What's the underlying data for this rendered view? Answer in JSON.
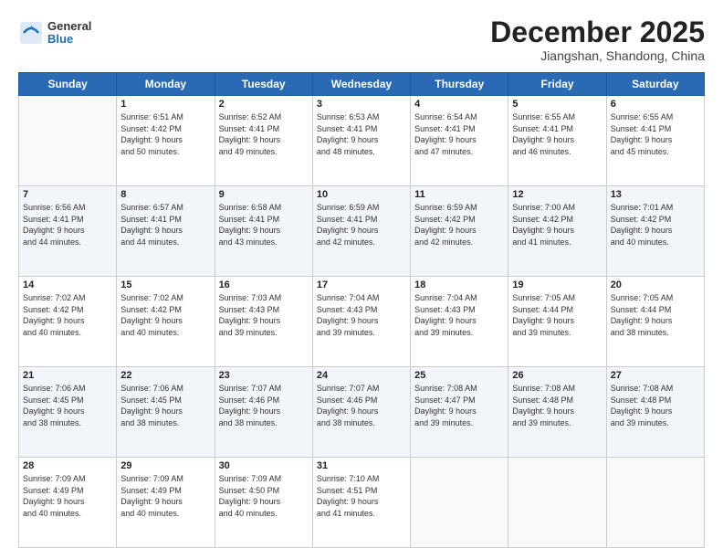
{
  "header": {
    "logo": {
      "general": "General",
      "blue": "Blue"
    },
    "title": "December 2025",
    "location": "Jiangshan, Shandong, China"
  },
  "weekdays": [
    "Sunday",
    "Monday",
    "Tuesday",
    "Wednesday",
    "Thursday",
    "Friday",
    "Saturday"
  ],
  "weeks": [
    [
      {
        "day": "",
        "info": ""
      },
      {
        "day": "1",
        "info": "Sunrise: 6:51 AM\nSunset: 4:42 PM\nDaylight: 9 hours\nand 50 minutes."
      },
      {
        "day": "2",
        "info": "Sunrise: 6:52 AM\nSunset: 4:41 PM\nDaylight: 9 hours\nand 49 minutes."
      },
      {
        "day": "3",
        "info": "Sunrise: 6:53 AM\nSunset: 4:41 PM\nDaylight: 9 hours\nand 48 minutes."
      },
      {
        "day": "4",
        "info": "Sunrise: 6:54 AM\nSunset: 4:41 PM\nDaylight: 9 hours\nand 47 minutes."
      },
      {
        "day": "5",
        "info": "Sunrise: 6:55 AM\nSunset: 4:41 PM\nDaylight: 9 hours\nand 46 minutes."
      },
      {
        "day": "6",
        "info": "Sunrise: 6:55 AM\nSunset: 4:41 PM\nDaylight: 9 hours\nand 45 minutes."
      }
    ],
    [
      {
        "day": "7",
        "info": "Sunrise: 6:56 AM\nSunset: 4:41 PM\nDaylight: 9 hours\nand 44 minutes."
      },
      {
        "day": "8",
        "info": "Sunrise: 6:57 AM\nSunset: 4:41 PM\nDaylight: 9 hours\nand 44 minutes."
      },
      {
        "day": "9",
        "info": "Sunrise: 6:58 AM\nSunset: 4:41 PM\nDaylight: 9 hours\nand 43 minutes."
      },
      {
        "day": "10",
        "info": "Sunrise: 6:59 AM\nSunset: 4:41 PM\nDaylight: 9 hours\nand 42 minutes."
      },
      {
        "day": "11",
        "info": "Sunrise: 6:59 AM\nSunset: 4:42 PM\nDaylight: 9 hours\nand 42 minutes."
      },
      {
        "day": "12",
        "info": "Sunrise: 7:00 AM\nSunset: 4:42 PM\nDaylight: 9 hours\nand 41 minutes."
      },
      {
        "day": "13",
        "info": "Sunrise: 7:01 AM\nSunset: 4:42 PM\nDaylight: 9 hours\nand 40 minutes."
      }
    ],
    [
      {
        "day": "14",
        "info": "Sunrise: 7:02 AM\nSunset: 4:42 PM\nDaylight: 9 hours\nand 40 minutes."
      },
      {
        "day": "15",
        "info": "Sunrise: 7:02 AM\nSunset: 4:42 PM\nDaylight: 9 hours\nand 40 minutes."
      },
      {
        "day": "16",
        "info": "Sunrise: 7:03 AM\nSunset: 4:43 PM\nDaylight: 9 hours\nand 39 minutes."
      },
      {
        "day": "17",
        "info": "Sunrise: 7:04 AM\nSunset: 4:43 PM\nDaylight: 9 hours\nand 39 minutes."
      },
      {
        "day": "18",
        "info": "Sunrise: 7:04 AM\nSunset: 4:43 PM\nDaylight: 9 hours\nand 39 minutes."
      },
      {
        "day": "19",
        "info": "Sunrise: 7:05 AM\nSunset: 4:44 PM\nDaylight: 9 hours\nand 39 minutes."
      },
      {
        "day": "20",
        "info": "Sunrise: 7:05 AM\nSunset: 4:44 PM\nDaylight: 9 hours\nand 38 minutes."
      }
    ],
    [
      {
        "day": "21",
        "info": "Sunrise: 7:06 AM\nSunset: 4:45 PM\nDaylight: 9 hours\nand 38 minutes."
      },
      {
        "day": "22",
        "info": "Sunrise: 7:06 AM\nSunset: 4:45 PM\nDaylight: 9 hours\nand 38 minutes."
      },
      {
        "day": "23",
        "info": "Sunrise: 7:07 AM\nSunset: 4:46 PM\nDaylight: 9 hours\nand 38 minutes."
      },
      {
        "day": "24",
        "info": "Sunrise: 7:07 AM\nSunset: 4:46 PM\nDaylight: 9 hours\nand 38 minutes."
      },
      {
        "day": "25",
        "info": "Sunrise: 7:08 AM\nSunset: 4:47 PM\nDaylight: 9 hours\nand 39 minutes."
      },
      {
        "day": "26",
        "info": "Sunrise: 7:08 AM\nSunset: 4:48 PM\nDaylight: 9 hours\nand 39 minutes."
      },
      {
        "day": "27",
        "info": "Sunrise: 7:08 AM\nSunset: 4:48 PM\nDaylight: 9 hours\nand 39 minutes."
      }
    ],
    [
      {
        "day": "28",
        "info": "Sunrise: 7:09 AM\nSunset: 4:49 PM\nDaylight: 9 hours\nand 40 minutes."
      },
      {
        "day": "29",
        "info": "Sunrise: 7:09 AM\nSunset: 4:49 PM\nDaylight: 9 hours\nand 40 minutes."
      },
      {
        "day": "30",
        "info": "Sunrise: 7:09 AM\nSunset: 4:50 PM\nDaylight: 9 hours\nand 40 minutes."
      },
      {
        "day": "31",
        "info": "Sunrise: 7:10 AM\nSunset: 4:51 PM\nDaylight: 9 hours\nand 41 minutes."
      },
      {
        "day": "",
        "info": ""
      },
      {
        "day": "",
        "info": ""
      },
      {
        "day": "",
        "info": ""
      }
    ]
  ]
}
